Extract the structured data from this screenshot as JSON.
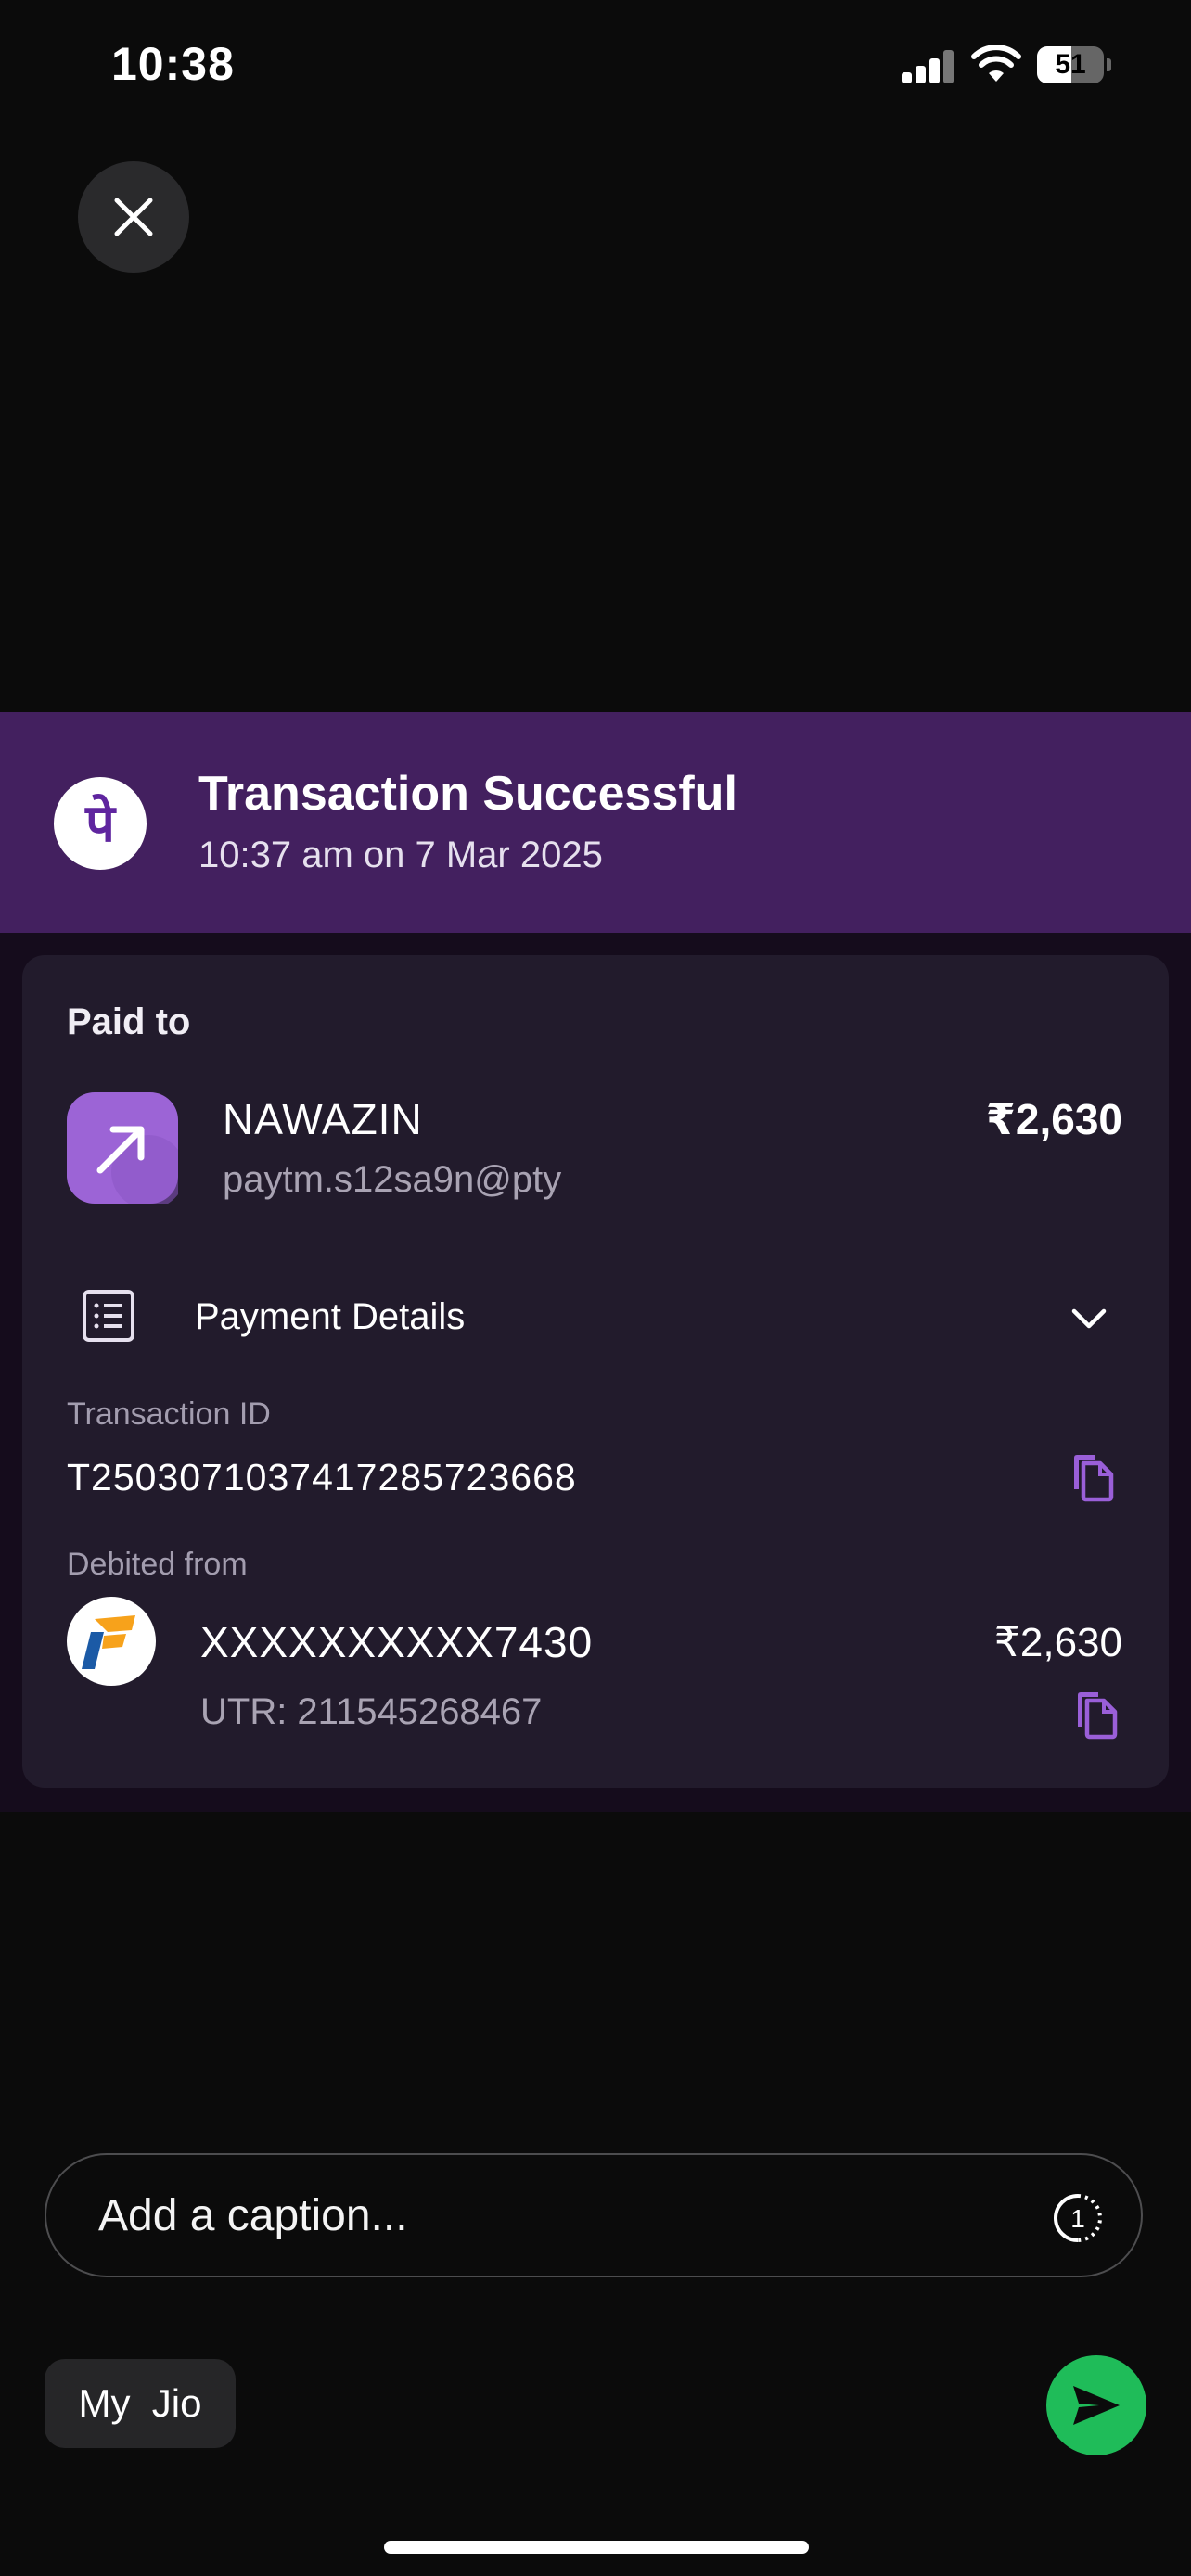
{
  "status_bar": {
    "time": "10:38",
    "battery": "51",
    "battery_level": 0.51
  },
  "header": {
    "logo_glyph": "पे",
    "title": "Transaction Successful",
    "subtitle": "10:37 am on 7 Mar 2025"
  },
  "paid_to": {
    "label": "Paid to",
    "name": "NAWAZIN",
    "upi_id": "paytm.s12sa9n@pty",
    "amount": "₹2,630"
  },
  "payment_details": {
    "label": "Payment Details"
  },
  "transaction": {
    "label": "Transaction ID",
    "value": "T2503071037417285723668"
  },
  "debited": {
    "label": "Debited from",
    "account": "XXXXXXXXXX7430",
    "utr": "UTR: 211545268467",
    "amount": "₹2,630"
  },
  "composer": {
    "caption_placeholder": "Add a caption...",
    "timer_label": "1",
    "chip_label": "My  Jio"
  },
  "colors": {
    "header_bg": "#43205f",
    "card_bg": "#221b2c",
    "accent_purple": "#9c64d6",
    "send_green": "#1fbc59"
  },
  "icons": [
    "close-icon",
    "phonepe-logo",
    "arrow-up-right-icon",
    "receipt-list-icon",
    "chevron-down-icon",
    "copy-icon",
    "bank-logo",
    "view-once-timer-icon",
    "send-icon"
  ]
}
